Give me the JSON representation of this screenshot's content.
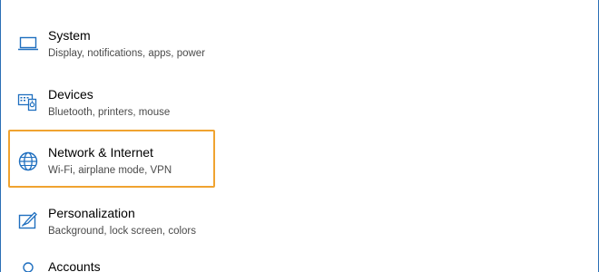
{
  "settings": {
    "items": [
      {
        "title": "System",
        "description": "Display, notifications, apps, power",
        "icon": "laptop-icon"
      },
      {
        "title": "Devices",
        "description": "Bluetooth, printers, mouse",
        "icon": "devices-icon"
      },
      {
        "title": "Network & Internet",
        "description": "Wi-Fi, airplane mode, VPN",
        "icon": "globe-icon",
        "highlighted": true
      },
      {
        "title": "Personalization",
        "description": "Background, lock screen, colors",
        "icon": "paint-icon"
      },
      {
        "title": "Accounts",
        "description": "",
        "icon": "person-icon"
      }
    ],
    "colors": {
      "icon": "#1f6fbf",
      "highlight_border": "#f0a330",
      "frame_border": "#2b6fb5"
    }
  }
}
